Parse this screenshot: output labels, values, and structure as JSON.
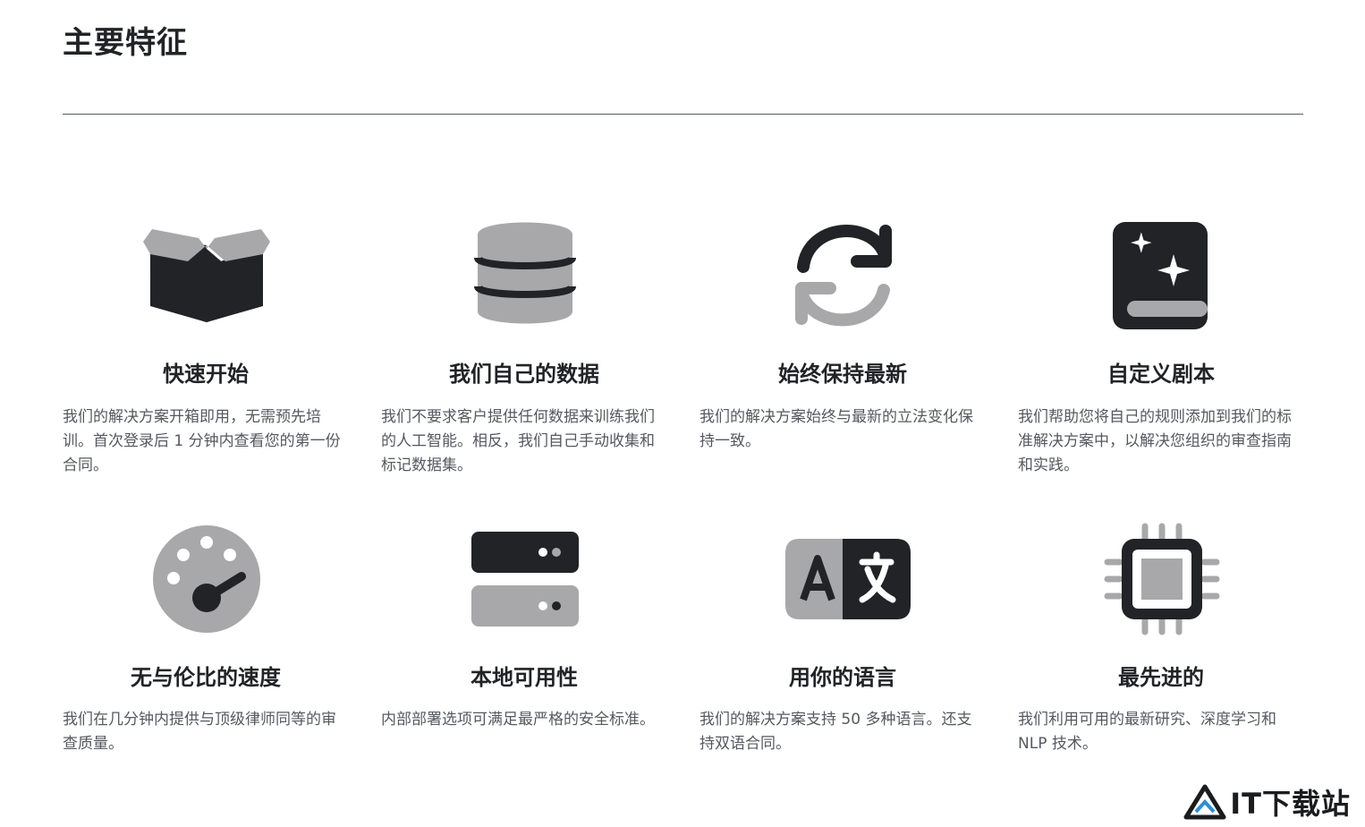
{
  "section": {
    "title": "主要特征"
  },
  "features": [
    {
      "icon": "box-icon",
      "title": "快速开始",
      "description": "我们的解决方案开箱即用，无需预先培训。首次登录后 1 分钟内查看您的第一份合同。"
    },
    {
      "icon": "database-icon",
      "title": "我们自己的数据",
      "description": "我们不要求客户提供任何数据来训练我们的人工智能。相反，我们自己手动收集和标记数据集。"
    },
    {
      "icon": "refresh-icon",
      "title": "始终保持最新",
      "description": "我们的解决方案始终与最新的立法变化保持一致。"
    },
    {
      "icon": "sparkle-book-icon",
      "title": "自定义剧本",
      "description": "我们帮助您将自己的规则添加到我们的标准解决方案中，以解决您组织的审查指南和实践。"
    },
    {
      "icon": "speedometer-icon",
      "title": "无与伦比的速度",
      "description": "我们在几分钟内提供与顶级律师同等的审查质量。"
    },
    {
      "icon": "server-icon",
      "title": "本地可用性",
      "description": "内部部署选项可满足最严格的安全标准。"
    },
    {
      "icon": "translate-icon",
      "title": "用你的语言",
      "description": "我们的解决方案支持 50 多种语言。还支持双语合同。"
    },
    {
      "icon": "cpu-chip-icon",
      "title": "最先进的",
      "description": "我们利用可用的最新研究、深度学习和 NLP 技术。"
    }
  ],
  "watermark": {
    "text": "IT下载站"
  },
  "colors": {
    "dark": "#212326",
    "gray": "#a8a8aa",
    "text": "#55595f",
    "accent_blue": "#2a8fd6"
  }
}
